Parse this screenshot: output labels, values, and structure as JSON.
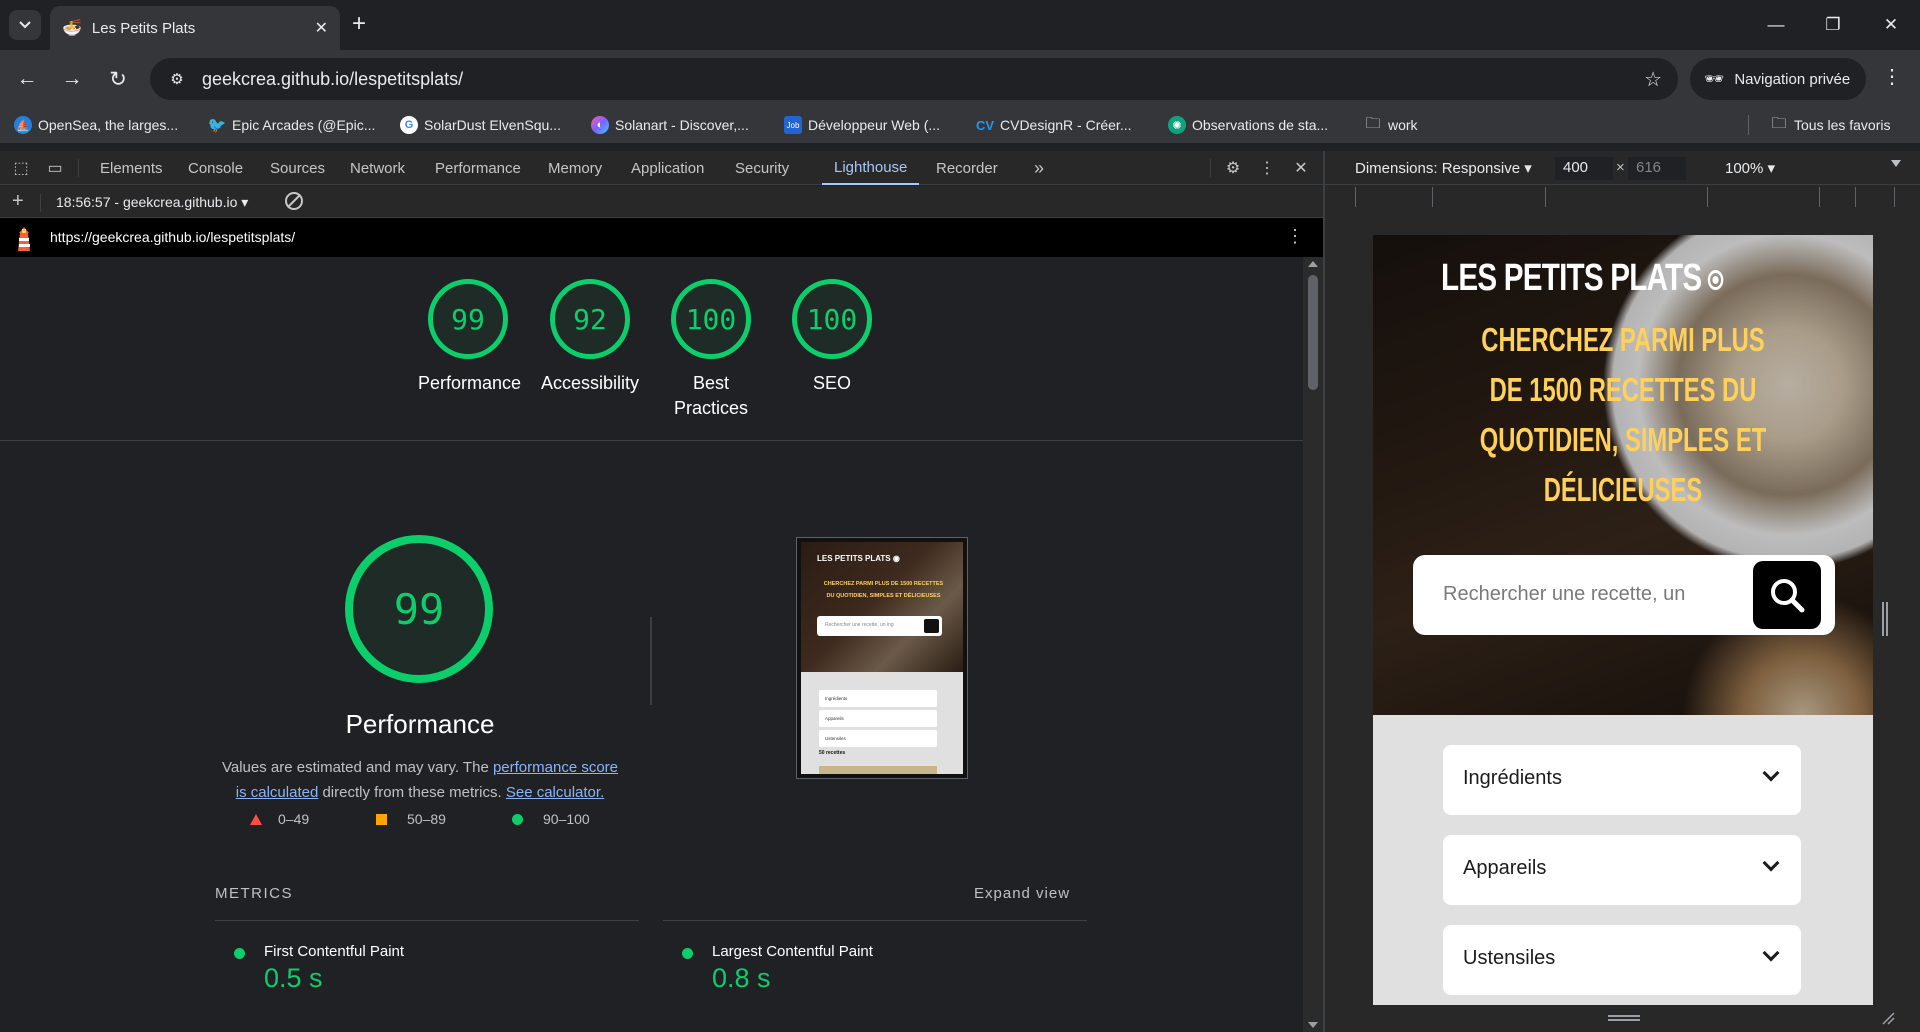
{
  "browser": {
    "tab_title": "Les Petits Plats",
    "url": "geekcrea.github.io/lespetitsplats/",
    "incognito_label": "Navigation privée",
    "bookmarks": [
      {
        "label": "OpenSea, the larges...",
        "color": "#2081e2",
        "icon": "opensea-icon"
      },
      {
        "label": "Epic Arcades (@Epic...",
        "color": "#1d9bf0",
        "icon": "twitter-icon"
      },
      {
        "label": "SolarDust ElvenSqu...",
        "color": "#ffffff",
        "icon": "google-icon"
      },
      {
        "label": "Solanart - Discover,...",
        "color": "#7b61ff",
        "icon": "solanart-icon"
      },
      {
        "label": "Développeur Web (...",
        "color": "#2264d1",
        "icon": "job-icon"
      },
      {
        "label": "CVDesignR - Créer...",
        "color": "#2196f3",
        "icon": "cvdesignr-icon"
      },
      {
        "label": "Observations de sta...",
        "color": "#10a37f",
        "icon": "chatgpt-icon"
      },
      {
        "label": "work",
        "color": "#e8eaed",
        "icon": "folder-icon"
      }
    ],
    "all_bookmarks": "Tous les favoris"
  },
  "devtools": {
    "tabs": [
      "Elements",
      "Console",
      "Sources",
      "Network",
      "Performance",
      "Memory",
      "Application",
      "Security",
      "Lighthouse",
      "Recorder"
    ],
    "active_tab": "Lighthouse",
    "report_selector": "18:56:57 - geekcrea.github.io ▾",
    "lighthouse_url": "https://geekcrea.github.io/lespetitsplats/"
  },
  "lighthouse": {
    "scores": [
      {
        "value": "99",
        "label": "Performance"
      },
      {
        "value": "92",
        "label": "Accessibility"
      },
      {
        "value": "100",
        "label": "Best Practices"
      },
      {
        "value": "100",
        "label": "SEO"
      }
    ],
    "main_score": "99",
    "main_title": "Performance",
    "desc_part1": "Values are estimated and may vary. The ",
    "desc_link1": "performance score is calculated",
    "desc_part2": " directly from these metrics. ",
    "desc_link2": "See calculator.",
    "legend": [
      {
        "range": "0–49",
        "color": "#ff4e42"
      },
      {
        "range": "50–89",
        "color": "#ffa400"
      },
      {
        "range": "90–100",
        "color": "#0cce6b"
      }
    ],
    "metrics_heading": "METRICS",
    "expand_view": "Expand view",
    "metrics": [
      {
        "name": "First Contentful Paint",
        "value": "0.5 s"
      },
      {
        "name": "Largest Contentful Paint",
        "value": "0.8 s"
      }
    ],
    "thumbnail": {
      "title": "LES PETITS PLATS ◉",
      "subtitle_line1": "CHERCHEZ PARMI PLUS DE 1500 RECETTES",
      "subtitle_line2": "DU QUOTIDIEN, SIMPLES ET DÉLICIEUSES",
      "search_placeholder": "Rechercher une recette, un ing",
      "filters": [
        "Ingrédients",
        "Appareils",
        "Ustensiles"
      ],
      "count": "50 recettes"
    }
  },
  "device": {
    "dimensions_label": "Dimensions: Responsive ▾",
    "width": "400",
    "height": "616",
    "zoom": "100% ▾"
  },
  "site": {
    "title": "LES PETITS PLATS",
    "subtitle": "CHERCHEZ PARMI PLUS DE 1500 RECETTES DU QUOTIDIEN, SIMPLES ET DÉLICIEUSES",
    "search_placeholder": "Rechercher une recette, un",
    "filters": [
      "Ingrédients",
      "Appareils",
      "Ustensiles"
    ]
  }
}
